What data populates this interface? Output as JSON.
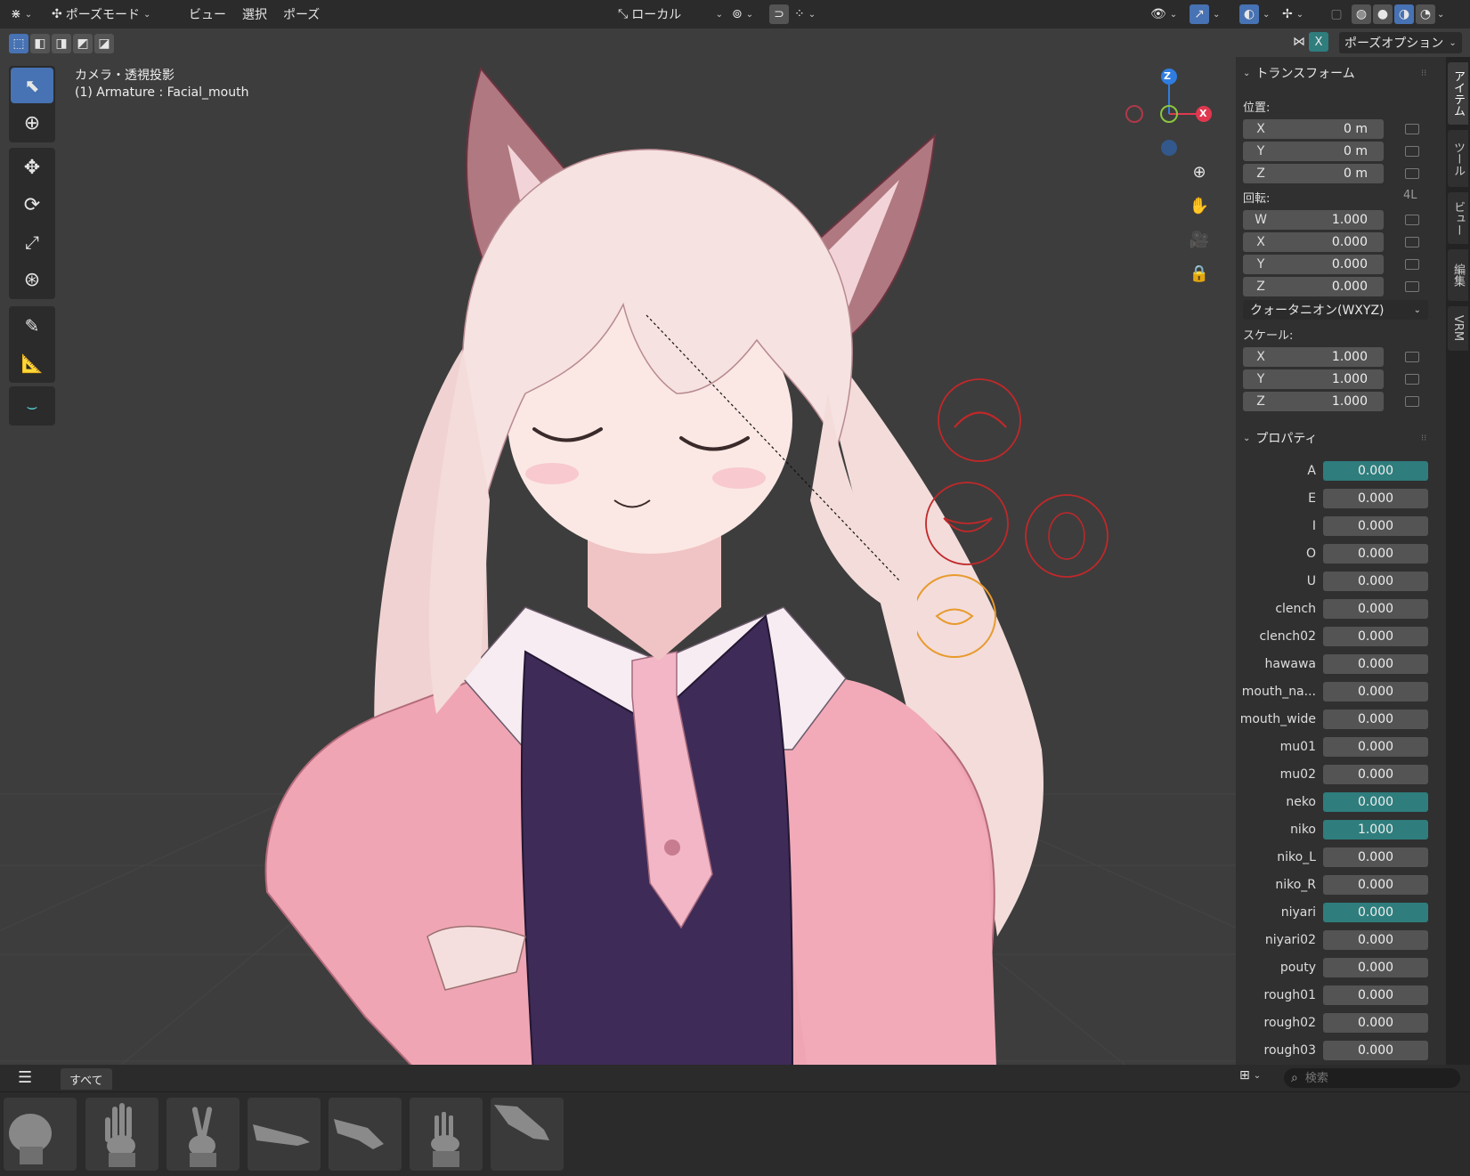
{
  "header": {
    "mode_label": "ポーズモード",
    "menu_view": "ビュー",
    "menu_select": "選択",
    "menu_pose": "ポーズ",
    "orientation": "ローカル",
    "pose_options": "ポーズオプション",
    "x_toggle": "X"
  },
  "viewport": {
    "view_name": "カメラ・透視投影",
    "object_info": "(1) Armature : Facial_mouth",
    "axis_x": "X",
    "axis_z": "Z"
  },
  "npanel": {
    "tabs": [
      "アイテム",
      "ツール",
      "ビュー",
      "編集",
      "VRM"
    ],
    "transform": {
      "title": "トランスフォーム",
      "location_label": "位置:",
      "location": [
        {
          "axis": "X",
          "value": "0 m"
        },
        {
          "axis": "Y",
          "value": "0 m"
        },
        {
          "axis": "Z",
          "value": "0 m"
        }
      ],
      "rotation_label": "回転:",
      "rotation_badge": "4L",
      "rotation": [
        {
          "axis": "W",
          "value": "1.000"
        },
        {
          "axis": "X",
          "value": "0.000"
        },
        {
          "axis": "Y",
          "value": "0.000"
        },
        {
          "axis": "Z",
          "value": "0.000"
        }
      ],
      "rotation_mode": "クォータニオン(WXYZ)",
      "scale_label": "スケール:",
      "scale": [
        {
          "axis": "X",
          "value": "1.000"
        },
        {
          "axis": "Y",
          "value": "1.000"
        },
        {
          "axis": "Z",
          "value": "1.000"
        }
      ]
    },
    "properties": {
      "title": "プロパティ",
      "items": [
        {
          "name": "A",
          "value": "0.000",
          "highlight": true
        },
        {
          "name": "E",
          "value": "0.000",
          "highlight": false
        },
        {
          "name": "I",
          "value": "0.000",
          "highlight": false
        },
        {
          "name": "O",
          "value": "0.000",
          "highlight": false
        },
        {
          "name": "U",
          "value": "0.000",
          "highlight": false
        },
        {
          "name": "clench",
          "value": "0.000",
          "highlight": false
        },
        {
          "name": "clench02",
          "value": "0.000",
          "highlight": false
        },
        {
          "name": "hawawa",
          "value": "0.000",
          "highlight": false
        },
        {
          "name": "mouth_na...",
          "value": "0.000",
          "highlight": false
        },
        {
          "name": "mouth_wide",
          "value": "0.000",
          "highlight": false
        },
        {
          "name": "mu01",
          "value": "0.000",
          "highlight": false
        },
        {
          "name": "mu02",
          "value": "0.000",
          "highlight": false
        },
        {
          "name": "neko",
          "value": "0.000",
          "highlight": true
        },
        {
          "name": "niko",
          "value": "1.000",
          "highlight": true
        },
        {
          "name": "niko_L",
          "value": "0.000",
          "highlight": false
        },
        {
          "name": "niko_R",
          "value": "0.000",
          "highlight": false
        },
        {
          "name": "niyari",
          "value": "0.000",
          "highlight": true
        },
        {
          "name": "niyari02",
          "value": "0.000",
          "highlight": false
        },
        {
          "name": "pouty",
          "value": "0.000",
          "highlight": false
        },
        {
          "name": "rough01",
          "value": "0.000",
          "highlight": false
        },
        {
          "name": "rough02",
          "value": "0.000",
          "highlight": false
        },
        {
          "name": "rough03",
          "value": "0.000",
          "highlight": false
        }
      ]
    }
  },
  "asset_bar": {
    "tab_all": "すべて",
    "search_placeholder": "検索"
  },
  "colors": {
    "accent": "#4772b3",
    "highlight_field": "#2f7d7d",
    "axis_x": "#e0384f",
    "axis_y": "#8cc63f",
    "axis_z": "#2f7de0",
    "active_bone": "#e89a2c",
    "bone_shape": "#c0282a"
  }
}
